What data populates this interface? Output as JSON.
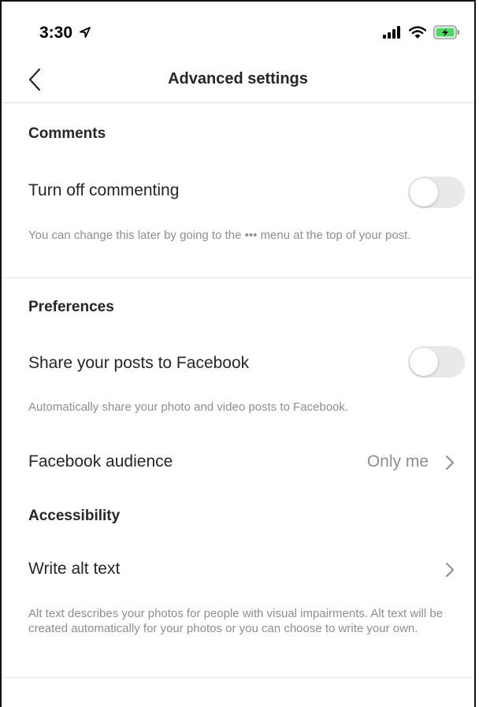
{
  "status_bar": {
    "time": "3:30",
    "location_icon": "location-arrow-icon",
    "signal_icon": "cellular-signal-icon",
    "wifi_icon": "wifi-icon",
    "battery_icon": "battery-charging-icon",
    "battery_color": "#4cd964"
  },
  "nav": {
    "back_icon": "chevron-left-icon",
    "title": "Advanced settings"
  },
  "comments": {
    "header": "Comments",
    "turn_off_label": "Turn off commenting",
    "turn_off_on": false,
    "description": "You can change this later by going to the ••• menu at the top of your post."
  },
  "preferences": {
    "header": "Preferences",
    "share_label": "Share your posts to Facebook",
    "share_on": false,
    "share_description": "Automatically share your photo and video posts to Facebook.",
    "audience_label": "Facebook audience",
    "audience_value": "Only me",
    "audience_chevron": "chevron-right-icon"
  },
  "accessibility": {
    "header": "Accessibility",
    "alt_label": "Write alt text",
    "alt_chevron": "chevron-right-icon",
    "alt_description": "Alt text describes your photos for people with visual impairments. Alt text will be created automatically for your photos or you can choose to write your own."
  }
}
